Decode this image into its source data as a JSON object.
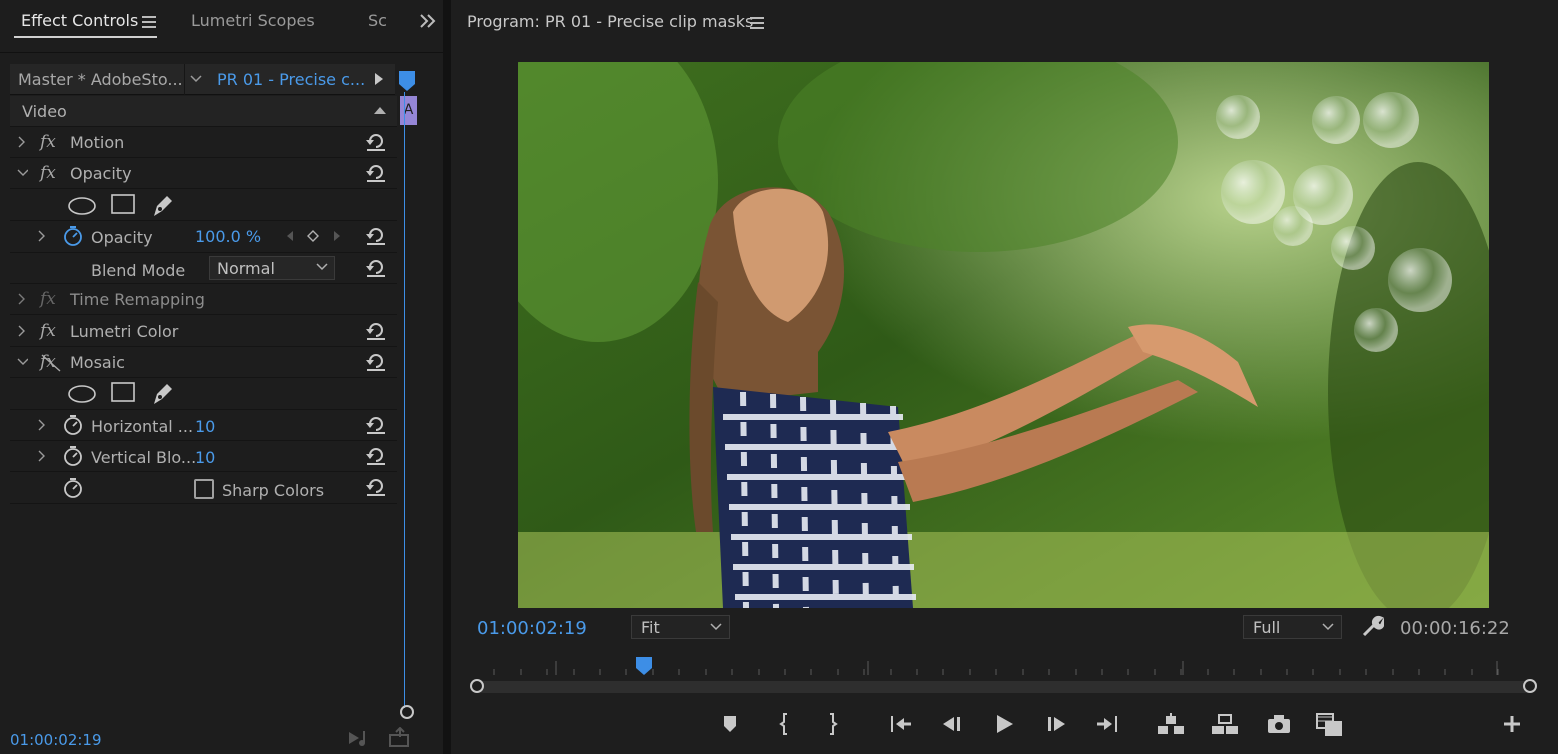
{
  "effect_controls": {
    "tabs": [
      "Effect Controls",
      "Lumetri Scopes",
      "Sc"
    ],
    "master_clip": "Master * AdobeSto...",
    "sequence_clip": "PR 01 - Precise c...",
    "video_label": "Video",
    "effects": {
      "motion": "Motion",
      "opacity": "Opacity",
      "opacity_param": "Opacity",
      "opacity_value": "100.0 %",
      "blend_mode_label": "Blend Mode",
      "blend_mode_value": "Normal",
      "time_remapping": "Time Remapping",
      "lumetri": "Lumetri Color",
      "mosaic": "Mosaic",
      "horizontal_label": "Horizontal ...",
      "horizontal_value": "10",
      "vertical_label": "Vertical Blo...",
      "vertical_value": "10",
      "sharp_colors": "Sharp Colors"
    },
    "timeline_clip_label": "A",
    "timecode": "01:00:02:19",
    "fx_glyph": "fx"
  },
  "program": {
    "title": "Program: PR 01 - Precise clip masks",
    "current_timecode": "01:00:02:19",
    "fit_value": "Fit",
    "resolution_value": "Full",
    "duration": "00:00:16:22"
  },
  "colors": {
    "accent_blue": "#4a9ae9",
    "clip_purple": "#9586d6"
  },
  "icons": {
    "panel_menu": "hamburger-menu-icon",
    "overflow": "double-chevron-right-icon",
    "reset": "reset-parameter-icon",
    "stopwatch": "stopwatch-icon",
    "mask_tools": [
      "ellipse-mask-icon",
      "rectangle-mask-icon",
      "pen-mask-icon"
    ],
    "transport": [
      "add-marker-icon",
      "mark-in-icon",
      "mark-out-icon",
      "go-to-in-icon",
      "step-back-icon",
      "play-icon",
      "step-forward-icon",
      "go-to-out-icon",
      "lift-icon",
      "extract-icon",
      "export-frame-icon",
      "compare-view-icon",
      "button-editor-icon"
    ]
  }
}
